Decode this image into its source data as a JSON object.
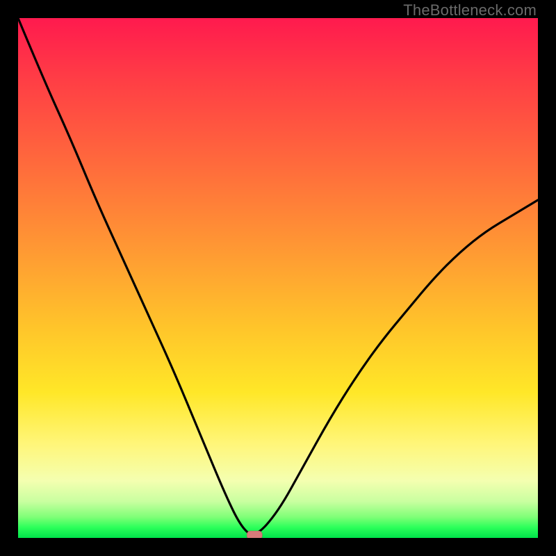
{
  "watermark": "TheBottleneck.com",
  "chart_data": {
    "type": "line",
    "title": "",
    "xlabel": "",
    "ylabel": "",
    "series": [
      {
        "name": "bottleneck-curve",
        "x": [
          0.0,
          0.05,
          0.1,
          0.15,
          0.2,
          0.25,
          0.3,
          0.35,
          0.4,
          0.43,
          0.455,
          0.5,
          0.55,
          0.6,
          0.65,
          0.7,
          0.75,
          0.8,
          0.85,
          0.9,
          0.95,
          1.0
        ],
        "values": [
          1.0,
          0.88,
          0.77,
          0.65,
          0.54,
          0.43,
          0.32,
          0.2,
          0.08,
          0.02,
          0.0,
          0.05,
          0.14,
          0.23,
          0.31,
          0.38,
          0.44,
          0.5,
          0.55,
          0.59,
          0.62,
          0.65
        ]
      }
    ],
    "min_marker": {
      "x": 0.455,
      "value": 0.0
    },
    "xlim": [
      0,
      1
    ],
    "ylim": [
      0,
      1
    ],
    "background_gradient": {
      "stops": [
        {
          "pos": 0.0,
          "color": "#ff1a4e"
        },
        {
          "pos": 0.45,
          "color": "#ff9a33"
        },
        {
          "pos": 0.72,
          "color": "#ffe728"
        },
        {
          "pos": 0.93,
          "color": "#c9ffa0"
        },
        {
          "pos": 1.0,
          "color": "#00e24a"
        }
      ]
    }
  }
}
